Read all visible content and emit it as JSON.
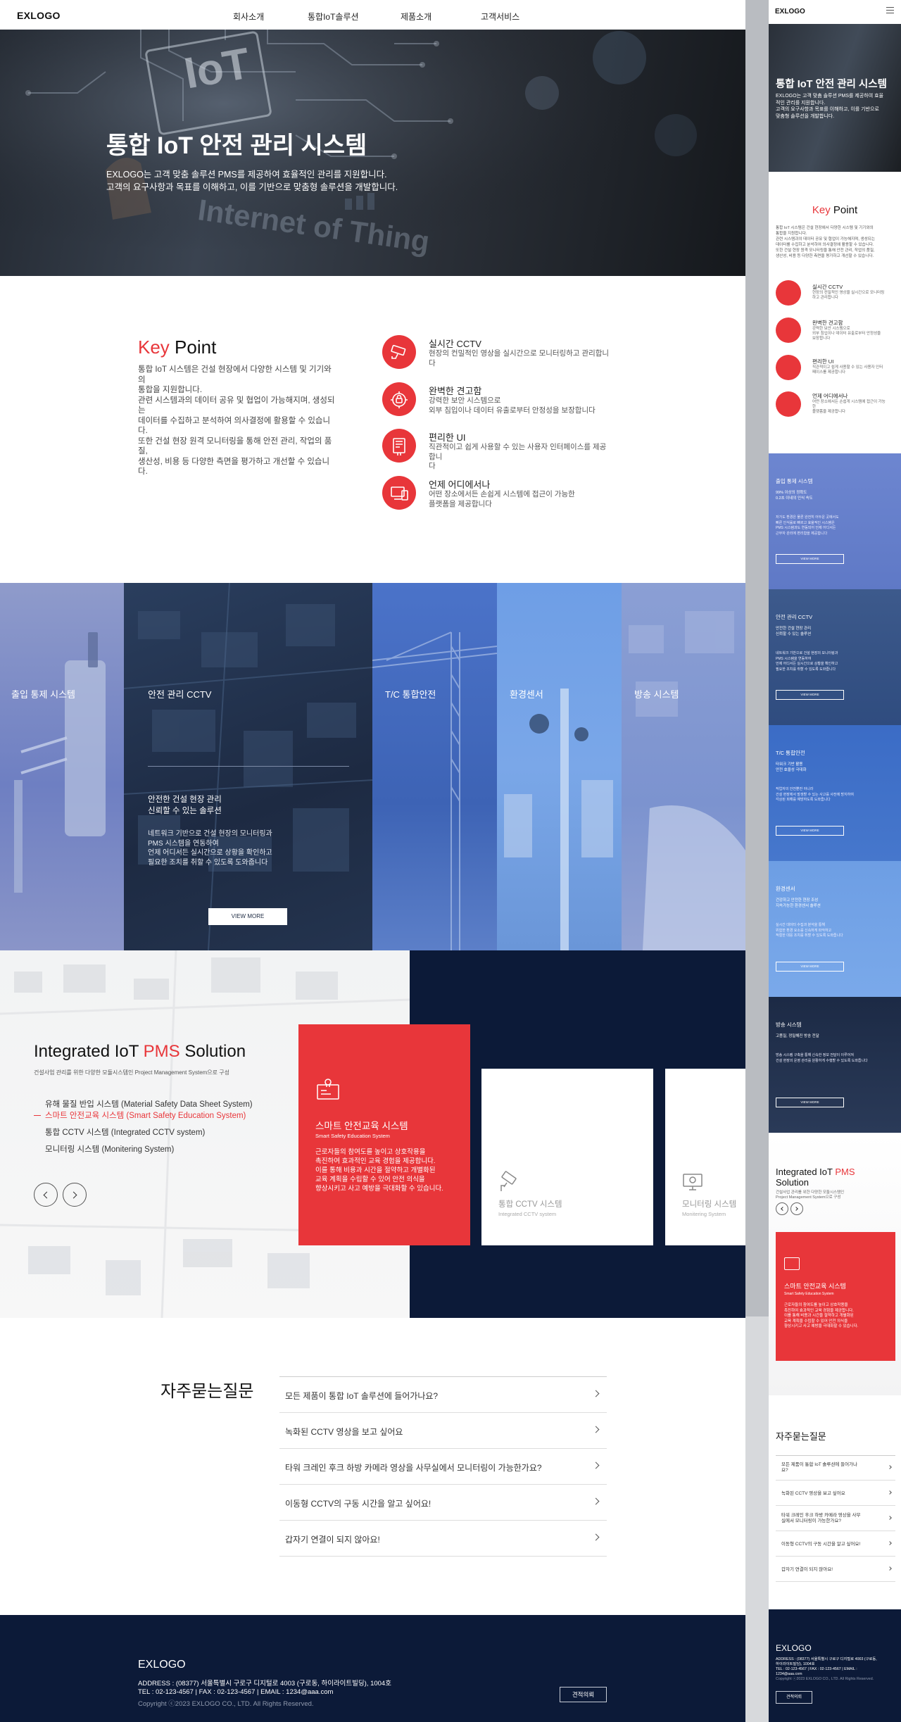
{
  "desktop": {
    "logo": "EXLOGO",
    "nav": [
      "회사소개",
      "통합IoT솔루션",
      "제품소개",
      "고객서비스"
    ],
    "hero": {
      "title": "통합 IoT 안전 관리 시스템",
      "subtitle_1": "EXLOGO는 고객 맞춤 솔루션 PMS를 제공하여 효율적인 관리를 지원합니다.",
      "subtitle_2": "고객의 요구사항과 목표를 이해하고, 이를 기반으로 맞춤형 솔루션을 개발합니다.",
      "bg_words": [
        "IoT",
        "Internet of Thing"
      ]
    },
    "key_point": {
      "title_accent": "Key",
      "title_rest": " Point",
      "desc": [
        "통합 IoT 시스템은 건설 현장에서 다양한 시스템 및 기기와의",
        "통합을 지원합니다.",
        "관련 시스템과의 데이터 공유 및 협업이 가능해지며, 생성되는",
        "데이터를 수집하고 분석하여 의사결정에 활용할 수 있습니다.",
        "또한 건설 현장 원격 모니터링을 통해 안전 관리, 작업의 품질,",
        "생산성, 비용 등 다양한 측면을 평가하고 개선할 수 있습니다."
      ],
      "features": [
        {
          "icon": "cctv-icon",
          "title": "실시간 CCTV",
          "desc": [
            "현장의 컨밀적인 영상을 실시간으로 모니터링하고 관리합니다"
          ]
        },
        {
          "icon": "lock-gear-icon",
          "title": "완벽한 견고함",
          "desc": [
            "강력한 보안 시스템으로",
            "외부 침입이나 데이터 유출로부터 안정성을 보장합니다"
          ]
        },
        {
          "icon": "ui-tool-icon",
          "title": "편리한 UI",
          "desc": [
            "직관적이고 쉽게 사용할 수 있는 사용자 인터페이스를 제공합니",
            "다"
          ]
        },
        {
          "icon": "devices-icon",
          "title": "언제 어디에서나",
          "desc": [
            "어떤 장소에서든 손쉽게 시스템에 접근이 가능한",
            "플랫폼을 제공합니다"
          ]
        }
      ]
    },
    "panels": {
      "p1": "출입 통제 시스템",
      "p2": "안전 관리 CCTV",
      "p2_head": [
        "안전한 건설 현장 관리",
        "신뢰할 수 있는 솔루션"
      ],
      "p2_body": [
        "네트워크 기반으로 건설 현장의 모니터링과",
        "PMS 시스템을 연동하여",
        "언제 어디서든 실시간으로 상황을 확인하고",
        "필요한 조치를 취할 수 있도록 도와줍니다"
      ],
      "p2_button": "VIEW MORE",
      "p3": "T/C 통합안전",
      "p4": "환경센서",
      "p5": "방송 시스템"
    },
    "pms": {
      "title_a": "Integrated IoT ",
      "title_b": "PMS",
      "title_c": " Solution",
      "subtitle": "건설사업 관리를 위한 다양한 모듈시스템인 Project Management System으로 구성",
      "list": [
        "유해 물질 반입 시스템 (Material Safety Data Sheet System)",
        "스마트 안전교육 시스템 (Smart Safety Education System)",
        "통합 CCTV 시스템 (Integrated CCTV system)",
        "모니터링 시스템 (Monitering System)"
      ],
      "active_index": 1,
      "card_main_title": "스마트 안전교육 시스템",
      "card_main_sub": "Smart Safety Education System",
      "card_main_desc": [
        "근로자들의 참여도를 높이고 상호작용을",
        "촉진하여 효과적인 교육 경험을 제공합니다.",
        "이를 통해 비용과 시간을 절약하고 개별화된",
        "교육 계획을 수립할 수 있어 안전 의식을",
        "향상시키고 사고 예방을 극대화할 수 있습니다."
      ],
      "card2_title": "통합 CCTV 시스템",
      "card2_sub": "Integrated CCTV system",
      "card3_title": "모니터링 시스템",
      "card3_sub": "Monitering System"
    },
    "faq": {
      "title": "자주묻는질문",
      "items": [
        "모든 제품이 통합 IoT 솔루션에 들어가나요?",
        "녹화된 CCTV 영상을 보고 싶어요",
        "타워 크레인 후크 하방 카메라 영상을 사무실에서 모니터링이 가능한가요?",
        "이동형 CCTV의 구동 시간을 알고 싶어요!",
        "갑자기 연결이 되지 않아요!"
      ]
    },
    "footer": {
      "logo": "EXLOGO",
      "address": "ADDRESS : (08377) 서울특별시 구로구 디지털로 4003 (구로동, 하이라이트빌딩), 1004호",
      "contact": "TEL : 02-123-4567 | FAX : 02-123-4567 | EMAIL : 1234@aaa.com",
      "copyright": "Copyright ⓒ2023 EXLOGO CO., LTD. All Rights Reserved.",
      "button": "견적의뢰"
    }
  },
  "mobile": {
    "logo": "EXLOGO",
    "menu_icon": "hamburger-icon",
    "hero_title": "통합 IoT 안전 관리 시스템",
    "hero_sub": [
      "EXLOGO는 고객 맞춤 솔루션 PMS를 제공하여 효율",
      "적인 관리를 지원합니다.",
      "고객의 요구사항과 목표를 이해하고, 이를 기반으로",
      "맞춤형 솔루션을 개발합니다."
    ],
    "kp_title_accent": "Key",
    "kp_title_rest": " Point",
    "kp_desc": [
      "통합 IoT 시스템은 건설 현장에서 다양한 시스템 및 기기와의",
      "통합을 지원합니다.",
      "관련 시스템과의 데이터 공유 및 협업이 가능해지며, 생성되는",
      "데이터를 수집하고 분석하여 의사결정에 활용할 수 있습니다.",
      "또한 건설 현장 원격 모니터링을 통해 안전 관리, 작업의 품질,",
      "생산성, 비용 등 다양한 측면을 평가하고 개선할 수 있습니다."
    ],
    "features": [
      {
        "title": "실시간 CCTV",
        "desc": [
          "현장의 컨밀적인 영상을 실시간으로 모니터링",
          "하고 관리합니다"
        ]
      },
      {
        "title": "완벽한 견고함",
        "desc": [
          "강력한 보안 시스템으로",
          "외부 침입이나 데이터 유출로부터 안정성을",
          "보장합니다"
        ]
      },
      {
        "title": "편리한 UI",
        "desc": [
          "직관적이고 쉽게 사용할 수 있는 사용자 인터",
          "페이스를 제공합니다"
        ]
      },
      {
        "title": "언제 어디에서나",
        "desc": [
          "어떤 장소에서든 손쉽게 시스템에 접근이 가능",
          "한",
          "플랫폼을 제공합니다"
        ]
      }
    ],
    "blocks": [
      {
        "title": "출입 통제 시스템",
        "head": [
          "99% 이상의 정확도",
          "0.2초 이내의 인식 속도"
        ],
        "body": [
          "저가도 환경은 물론 완전히 어두운 곳에서도",
          "빠른 인식률로 빠르고 효율적인 시스템은",
          "PMS 시스템과도 연동되어 언제 어디서든",
          "근무자 관리에 편리함을 제공합니다"
        ],
        "btn": "VIEW MORE"
      },
      {
        "title": "안전 관리 CCTV",
        "head": [
          "안전한 건설 현장 관리",
          "신뢰할 수 있는 솔루션"
        ],
        "body": [
          "네트워크 기반으로 건설 현장의 모니터링과",
          "PMS 시스템을 연동하여",
          "언제 어디서든 실시간으로 상황을 확인하고",
          "필요한 조치를 취할 수 있도록 도와줍니다"
        ],
        "btn": "VIEW MORE"
      },
      {
        "title": "T/C 통합안전",
        "head": [
          "타워크 기반 활용",
          "안전 효율성 극대화"
        ],
        "body": [
          "작업자의 안전뿐만 아니라",
          "건설 현장에서 발생할 수 있는 사고를 사전에 방지하여",
          "각상된 피해를 예방하도록 도와줍니다"
        ],
        "btn": "VIEW MORE"
      },
      {
        "title": "환경센서",
        "head": [
          "건강하고 안전한 현장 조성",
          "지속가능한 환경센서 솔루션"
        ],
        "body": [
          "실시간 데이터 수집과 분석을 통해",
          "위험한 환경 요소를 신속하게 파악하고",
          "적절한 대응 조치를 취할 수 있도록 도와줍니다"
        ],
        "btn": "VIEW MORE"
      },
      {
        "title": "방송 시스템",
        "head": [
          "고품질, 정밀해진 방송 전달"
        ],
        "body": [
          "방송 시스템 구축을 통해 신속한 정보 전달이 이루어져",
          "건설 현장의 운영 관리를 원활하게 수행할 수 있도록 도와줍니다"
        ],
        "btn": "VIEW MORE"
      }
    ],
    "pms_title_a": "Integrated IoT ",
    "pms_title_b": "PMS",
    "pms_title_c": "Solution",
    "pms_sub": [
      "건설사업 관리를 위한 다양한 모듈시스템인",
      "Project Management System으로 구성"
    ],
    "card_title": "스마트 안전교육 시스템",
    "card_sub": "Smart Safety Education System",
    "card_desc": [
      "근로자들의 참여도를 높이고 상호작용을",
      "촉진하여 효과적인 교육 경험을 제공합니다.",
      "이를 통해 비용과 시간을 절약하고 개별화된",
      "교육 계획을 수립할 수 있어 안전 의식을",
      "향상시키고 사고 예방을 극대화할 수 있습니다."
    ],
    "faq_title": "자주묻는질문",
    "faq": [
      [
        "모든 제품이 통합 IoT 솔루션에 들어가나",
        "요?"
      ],
      [
        "녹화된 CCTV 영상을 보고 싶어요"
      ],
      [
        "타워 크레인 후크 하방 카메라 영상을 사무",
        "실에서 모니터링이 가능한가요?"
      ],
      [
        "이동형 CCTV의 구동 시간을 알고 싶어요!"
      ],
      [
        "갑자기 연결이 되지 않아요!"
      ]
    ],
    "footer_logo": "EXLOGO",
    "footer_lines": [
      "ADDRESS : (08377) 서울특별시 구로구 디지털로 4003 (구로동,",
      "하이라이트빌딩), 1004호",
      "TEL : 02-123-4567 | FAX : 02-123-4567 | EMAIL :",
      "1234@aaa.com",
      "Copyright ⓒ2023 EXLOGO CO., LTD. All Rights Reserved."
    ],
    "footer_button": "견적의뢰"
  },
  "colors": {
    "accent": "#e8363a",
    "navy": "#0c1a38",
    "blue_overlay": "#4a6fc4"
  }
}
